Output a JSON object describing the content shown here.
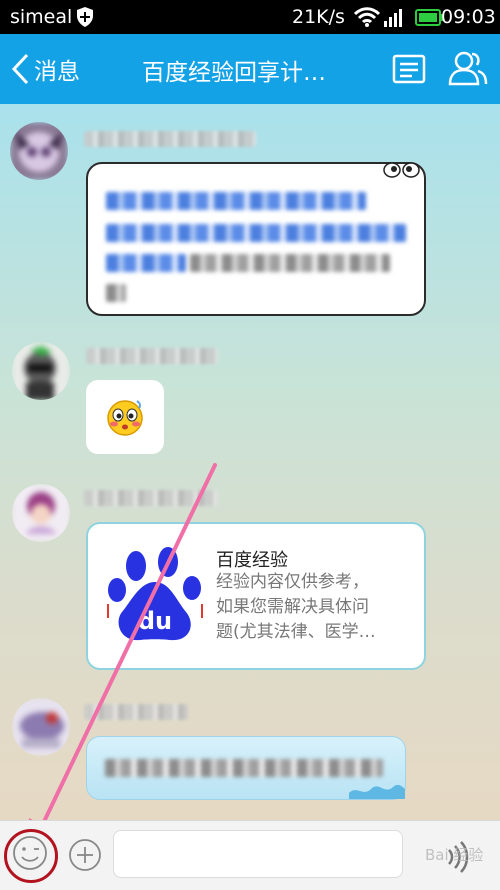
{
  "status_bar": {
    "carrier": "simeal",
    "net_speed": "21K/s",
    "time": "09:03"
  },
  "header": {
    "back_label": "消息",
    "title": "百度经验回享计…"
  },
  "messages": [
    {
      "type": "text",
      "sender_blurred": true,
      "content_blurred": true
    },
    {
      "type": "emoji",
      "sender_blurred": true,
      "emoji": "blushing-face"
    },
    {
      "type": "link_card",
      "sender_blurred": true,
      "card": {
        "title": "百度经验",
        "desc_lines": [
          "经验内容仅供参考，",
          "如果您需解决具体问",
          "题(尤其法律、医学…"
        ],
        "logo_text": "du"
      }
    },
    {
      "type": "text",
      "sender_blurred": true,
      "content_blurred": true
    }
  ],
  "input_bar": {
    "placeholder": "",
    "watermark": "Bai 经验"
  },
  "colors": {
    "header": "#14a2e6",
    "annotation_circle": "#b3121f",
    "annotation_arrow": "#ef6fa6"
  }
}
